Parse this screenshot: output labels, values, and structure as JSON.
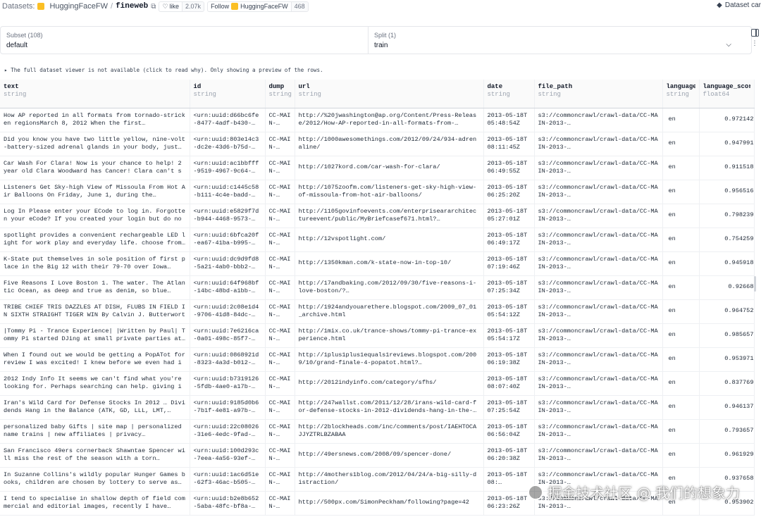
{
  "topbar": {
    "datasets_label": "Datasets:",
    "owner": "HuggingFaceFW",
    "separator": "/",
    "dataset_name": "fineweb",
    "like_label": "like",
    "like_count": "2.07k",
    "follow_label": "Follow",
    "follow_org": "HuggingFaceFW",
    "follow_count": "468",
    "dataset_card_label": "Dataset car"
  },
  "selectors": {
    "subset_label": "Subset (108)",
    "subset_value": "default",
    "split_label": "Split (1)",
    "split_value": "train"
  },
  "notice": "▸ The full dataset viewer is not available (click to read why). Only showing a preview of the rows.",
  "columns": [
    {
      "name": "text",
      "type": "string"
    },
    {
      "name": "id",
      "type": "string"
    },
    {
      "name": "dump",
      "type": "string"
    },
    {
      "name": "url",
      "type": "string"
    },
    {
      "name": "date",
      "type": "string"
    },
    {
      "name": "file_path",
      "type": "string"
    },
    {
      "name": "language",
      "type": "string"
    },
    {
      "name": "language_score",
      "type": "float64"
    }
  ],
  "rows": [
    {
      "text": "How AP reported in all formats from tornado-stricken regionsMarch 8, 2012 When the first…",
      "id": "<urn:uuid:d66bc6fe-8477-4adf-b430-…",
      "dump": "CC-MAIN-…",
      "url": "http://%20jwashington@ap.org/Content/Press-Release/2012/How-AP-reported-in-all-formats-from-…",
      "date": "2013-05-18T05:48:54Z",
      "file_path": "s3://commoncrawl/crawl-data/CC-MAIN-2013-…",
      "language": "en",
      "language_score": "0.972142"
    },
    {
      "text": "Did you know you have two little yellow, nine-volt-battery-sized adrenal glands in your body, just…",
      "id": "<urn:uuid:803e14c3-dc2e-43d6-b75d-…",
      "dump": "CC-MAIN-…",
      "url": "http://1000awesomethings.com/2012/09/24/934-adrenaline/",
      "date": "2013-05-18T08:11:45Z",
      "file_path": "s3://commoncrawl/crawl-data/CC-MAIN-2013-…",
      "language": "en",
      "language_score": "0.947991"
    },
    {
      "text": "Car Wash For Clara! Now is your chance to help! 2 year old Clara Woodward has Cancer! Clara can't sa…",
      "id": "<urn:uuid:ac1bbfff-9519-4967-9c64-…",
      "dump": "CC-MAIN-…",
      "url": "http://1027kord.com/car-wash-for-clara/",
      "date": "2013-05-18T06:49:55Z",
      "file_path": "s3://commoncrawl/crawl-data/CC-MAIN-2013-…",
      "language": "en",
      "language_score": "0.911518"
    },
    {
      "text": "Listeners Get Sky-high View of Missoula From Hot Air Balloons On Friday, June 1, during the…",
      "id": "<urn:uuid:c1445c58-b111-4c4e-badd-…",
      "dump": "CC-MAIN-…",
      "url": "http://1075zoofm.com/listeners-get-sky-high-view-of-missoula-from-hot-air-balloons/",
      "date": "2013-05-18T06:25:20Z",
      "file_path": "s3://commoncrawl/crawl-data/CC-MAIN-2013-…",
      "language": "en",
      "language_score": "0.956516"
    },
    {
      "text": "Log In Please enter your ECode to log in. Forgotten your eCode? If you created your login but do not…",
      "id": "<urn:uuid:e5829f7d-b944-4468-9573-…",
      "dump": "CC-MAIN-…",
      "url": "http://1105govinfoevents.com/enterpriseararchitectureevent/public/MyBriefcasef671.html?…",
      "date": "2013-05-18T05:27:01Z",
      "file_path": "s3://commoncrawl/crawl-data/CC-MAIN-2013-…",
      "language": "en",
      "language_score": "0.798239"
    },
    {
      "text": "spotlight provides a convenient rechargeable LED light for work play and everyday life. choose from…",
      "id": "<urn:uuid:6bfca20f-ea67-41ba-b995-…",
      "dump": "CC-MAIN-…",
      "url": "http://12vspotlight.com/",
      "date": "2013-05-18T06:49:17Z",
      "file_path": "s3://commoncrawl/crawl-data/CC-MAIN-2013-…",
      "language": "en",
      "language_score": "0.754259"
    },
    {
      "text": "K-State put themselves in sole position of first place in the Big 12 with their 79-70 over Iowa…",
      "id": "<urn:uuid:dc9d9fd8-5a21-4ab0-bbb2-…",
      "dump": "CC-MAIN-…",
      "url": "http://1350kman.com/k-state-now-in-top-10/",
      "date": "2013-05-18T07:19:46Z",
      "file_path": "s3://commoncrawl/crawl-data/CC-MAIN-2013-…",
      "language": "en",
      "language_score": "0.945918"
    },
    {
      "text": "Five Reasons I Love Boston 1. The water. The Atlantic Ocean, as deep and true as denim, so blue…",
      "id": "<urn:uuid:64f968bf-14bc-48bd-a1bb-…",
      "dump": "CC-MAIN-…",
      "url": "http://17andbaking.com/2012/09/30/five-reasons-i-love-boston/?…",
      "date": "2013-05-18T07:25:34Z",
      "file_path": "s3://commoncrawl/crawl-data/CC-MAIN-2013-…",
      "language": "en",
      "language_score": "0.92668"
    },
    {
      "text": "TRIBE CHIEF TRIS DAZZLES AT DISH, FLUBS IN FIELD IN SIXTH STRAIGHT TIGER WIN By Calvin J. Butterworth…",
      "id": "<urn:uuid:2c08e1d4-9706-41d8-84dc-…",
      "dump": "CC-MAIN-…",
      "url": "http://1924andyouarethere.blogspot.com/2009_07_01_archive.html",
      "date": "2013-05-18T05:54:12Z",
      "file_path": "s3://commoncrawl/crawl-data/CC-MAIN-2013-…",
      "language": "en",
      "language_score": "0.964752"
    },
    {
      "text": "|Tommy Pi - Trance Experience| |Written by Paul| Tommy Pi started DJing at small private parties at…",
      "id": "<urn:uuid:7e6216ca-0a01-498c-85f7-…",
      "dump": "CC-MAIN-…",
      "url": "http://1mix.co.uk/trance-shows/tommy-pi-trance-experience.html",
      "date": "2013-05-18T05:54:17Z",
      "file_path": "s3://commoncrawl/crawl-data/CC-MAIN-2013-…",
      "language": "en",
      "language_score": "0.985657"
    },
    {
      "text": "When I found out we would be getting a PopATot for review I was excited! I knew before we even had it…",
      "id": "<urn:uuid:0868921d-8323-4a3d-b012-…",
      "dump": "CC-MAIN-…",
      "url": "http://1plus1plus1equals1reviews.blogspot.com/2009/10/grand-finale-4-popatot.html?…",
      "date": "2013-05-18T06:19:38Z",
      "file_path": "s3://commoncrawl/crawl-data/CC-MAIN-2013-…",
      "language": "en",
      "language_score": "0.953971"
    },
    {
      "text": "2012 Indy Info It seems we can't find what you're looking for. Perhaps searching can help. giving it…",
      "id": "<urn:uuid:b7319126-5fdb-4ae0-a17b-…",
      "dump": "CC-MAIN-…",
      "url": "http://2012indyinfo.com/category/sfhs/",
      "date": "2013-05-18T08:07:40Z",
      "file_path": "s3://commoncrawl/crawl-data/CC-MAIN-2013-…",
      "language": "en",
      "language_score": "0.837769"
    },
    {
      "text": "Iran's Wild Card for Defense Stocks In 2012 … Dividends Hang in the Balance (ATK, GD, LLL, LMT,…",
      "id": "<urn:uuid:9185d0b6-7b1f-4e81-a97b-…",
      "dump": "CC-MAIN-…",
      "url": "http://247wallst.com/2011/12/28/irans-wild-card-for-defense-stocks-in-2012-dividends-hang-in-the-…",
      "date": "2013-05-18T07:25:54Z",
      "file_path": "s3://commoncrawl/crawl-data/CC-MAIN-2013-…",
      "language": "en",
      "language_score": "0.946137"
    },
    {
      "text": "personalized baby Gifts | site map | personalized name trains | new affiliates | privacy…",
      "id": "<urn:uuid:22c08026-31e6-4edc-9fad-…",
      "dump": "CC-MAIN-…",
      "url": "http://2blockheads.com/inc/comments/post/IAEHTOCAJJYZTRLBZABAA",
      "date": "2013-05-18T06:56:04Z",
      "file_path": "s3://commoncrawl/crawl-data/CC-MAIN-2013-…",
      "language": "en",
      "language_score": "0.793657"
    },
    {
      "text": "San Francisco 49ers cornerback Shawntae Spencer will miss the rest of the season with a torn…",
      "id": "<urn:uuid:100d293c-7eea-4a56-93ef-…",
      "dump": "CC-MAIN-…",
      "url": "http://49ersnews.com/2008/09/spencer-done/",
      "date": "2013-05-18T06:20:38Z",
      "file_path": "s3://commoncrawl/crawl-data/CC-MAIN-2013-…",
      "language": "en",
      "language_score": "0.961929"
    },
    {
      "text": "In Suzanne Collins's wildly popular Hunger Games books, children are chosen by lottery to serve as…",
      "id": "<urn:uuid:1ac6d51e-62f3-46ac-b505-…",
      "dump": "CC-MAIN-…",
      "url": "http://4mothers1blog.com/2012/04/24/a-big-silly-distraction/",
      "date": "2013-05-18T08:…",
      "file_path": "s3://commoncrawl/crawl-data/CC-MAIN-2013-…",
      "language": "en",
      "language_score": "0.937658"
    },
    {
      "text": "I tend to specialise in shallow depth of field commercial and editorial images, recently I have…",
      "id": "<urn:uuid:b2e8b652-5aba-48fc-bf8a-…",
      "dump": "CC-MAIN-…",
      "url": "http://500px.com/SimonPeckham/following?page=42",
      "date": "2013-05-18T06:23:26Z",
      "file_path": "s3://commoncrawl/crawl-data/CC-MAIN-2013-…",
      "language": "en",
      "language_score": "0.953902"
    }
  ],
  "watermark": "掘金技术社区 @ 我们的想象力"
}
